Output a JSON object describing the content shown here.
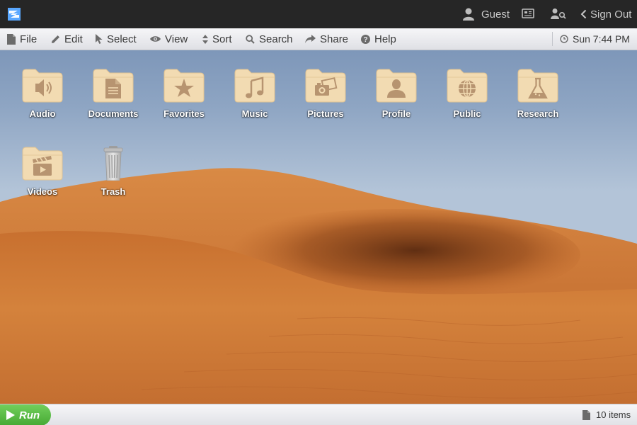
{
  "topbar": {
    "user_label": "Guest",
    "signout_label": "Sign Out"
  },
  "menu": {
    "file": "File",
    "edit": "Edit",
    "select": "Select",
    "view": "View",
    "sort": "Sort",
    "search": "Search",
    "share": "Share",
    "help": "Help",
    "clock": "Sun 7:44 PM"
  },
  "desktop": {
    "icons": [
      {
        "label": "Audio",
        "icon": "speaker-icon"
      },
      {
        "label": "Documents",
        "icon": "document-icon"
      },
      {
        "label": "Favorites",
        "icon": "star-icon"
      },
      {
        "label": "Music",
        "icon": "music-note-icon"
      },
      {
        "label": "Pictures",
        "icon": "camera-icon"
      },
      {
        "label": "Profile",
        "icon": "person-icon"
      },
      {
        "label": "Public",
        "icon": "globe-icon"
      },
      {
        "label": "Research",
        "icon": "flask-icon"
      },
      {
        "label": "Videos",
        "icon": "clapperboard-icon"
      },
      {
        "label": "Trash",
        "icon": "trash-icon"
      }
    ]
  },
  "bottombar": {
    "run_label": "Run",
    "items_label": "10 items"
  },
  "colors": {
    "topbar_bg": "#262626",
    "folder": "#f2dbb2",
    "folder_glyph": "#b79470",
    "run_green": "#55b842",
    "sand": "#c96d2c"
  }
}
